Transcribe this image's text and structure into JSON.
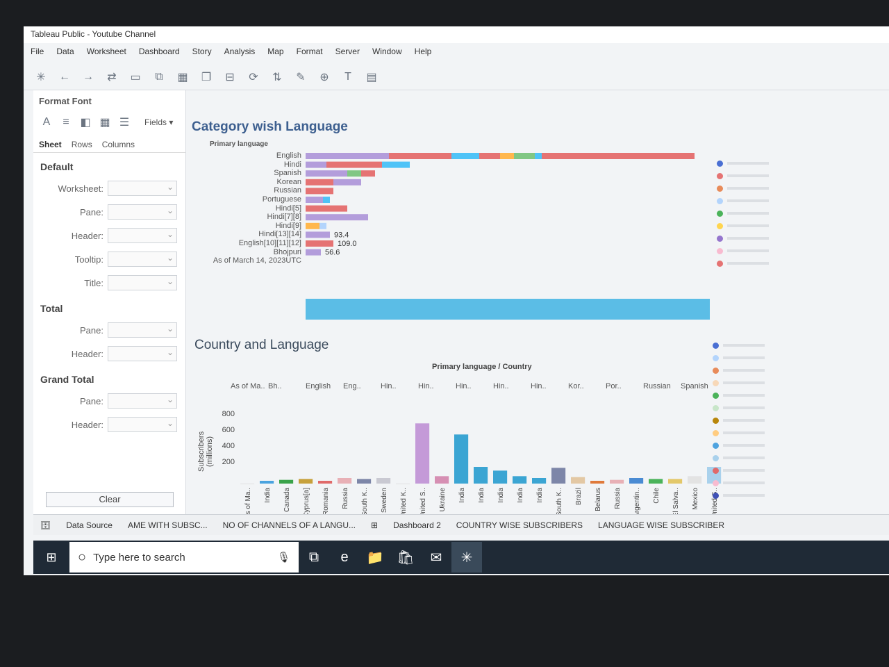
{
  "window": {
    "title": "Tableau Public - Youtube Channel"
  },
  "menu": [
    "File",
    "Data",
    "Worksheet",
    "Dashboard",
    "Story",
    "Analysis",
    "Map",
    "Format",
    "Server",
    "Window",
    "Help"
  ],
  "format_pane": {
    "title": "Format Font",
    "fields_label": "Fields ▾",
    "tabs": [
      "Sheet",
      "Rows",
      "Columns"
    ],
    "sections": [
      {
        "title": "Default",
        "fields": [
          "Worksheet:",
          "Pane:",
          "Header:",
          "Tooltip:",
          "Title:"
        ]
      },
      {
        "title": "Total",
        "fields": [
          "Pane:",
          "Header:"
        ]
      },
      {
        "title": "Grand Total",
        "fields": [
          "Pane:",
          "Header:"
        ]
      }
    ],
    "clear_label": "Clear"
  },
  "chart1": {
    "title": "Category wish Language",
    "header": "Primary language",
    "row_labels": [
      "English",
      "Hindi",
      "Spanish",
      "Korean",
      "Russian",
      "Portuguese",
      "Hindi[5]",
      "Hindi[7][8]",
      "Hindi[9]",
      "Hindi[13][14]",
      "English[10][11][12]",
      "Bhojpuri",
      "As of March 14, 2023UTC"
    ],
    "visible_values": [
      "93.4",
      "109.0",
      "56.6"
    ]
  },
  "chart2": {
    "title": "Country and Language",
    "header": "Primary language / Country",
    "language_headers": [
      "As of Ma..",
      "Bh..",
      "English",
      "Eng..",
      "Hin..",
      "Hin..",
      "Hin..",
      "Hin..",
      "Hin..",
      "Kor..",
      "Por..",
      "Russian",
      "Spanish"
    ],
    "y_axis_label": "Subscribers (millions)",
    "y_ticks": [
      "800",
      "600",
      "400",
      "200"
    ]
  },
  "chart_data": {
    "type": "bar",
    "categories": [
      "As of Ma..",
      "India",
      "Canada",
      "Cyprus[a]",
      "Romania",
      "Russia",
      "South K..",
      "Sweden",
      "United K..",
      "United S..",
      "Ukraine",
      "India",
      "India",
      "India",
      "India",
      "India",
      "South K..",
      "Brazil",
      "Belarus",
      "Russia",
      "Argentin..",
      "Chile",
      "El Salva..",
      "Mexico",
      "United S.."
    ],
    "values": [
      0,
      30,
      40,
      50,
      30,
      60,
      50,
      60,
      0,
      650,
      80,
      530,
      180,
      140,
      80,
      60,
      170,
      70,
      30,
      40,
      60,
      50,
      50,
      80,
      180
    ],
    "colors": [
      "#cccccc",
      "#4aa3df",
      "#3aa34a",
      "#c7a13c",
      "#e06a6a",
      "#e8b0b6",
      "#7d86a8",
      "#c9c9d2",
      "#cccccc",
      "#c49ad8",
      "#d68fb3",
      "#3ba5d3",
      "#3ba5d3",
      "#3ba5d3",
      "#3ba5d3",
      "#3ba5d3",
      "#7d86a8",
      "#e3c8a4",
      "#e07a3b",
      "#e8b0b6",
      "#4a8bd3",
      "#4bb35a",
      "#e3c86a",
      "#e3e3e3",
      "#a9d1ec"
    ],
    "ylabel": "Subscribers (millions)",
    "ylim": [
      0,
      900
    ]
  },
  "tabs": [
    "Data Source",
    "AME WITH SUBSC...",
    "NO OF CHANNELS OF A LANGU...",
    "Dashboard 2",
    "COUNTRY WISE SUBSCRIBERS",
    "LANGUAGE WISE SUBSCRIBER"
  ],
  "taskbar": {
    "search_placeholder": "Type here to search"
  }
}
